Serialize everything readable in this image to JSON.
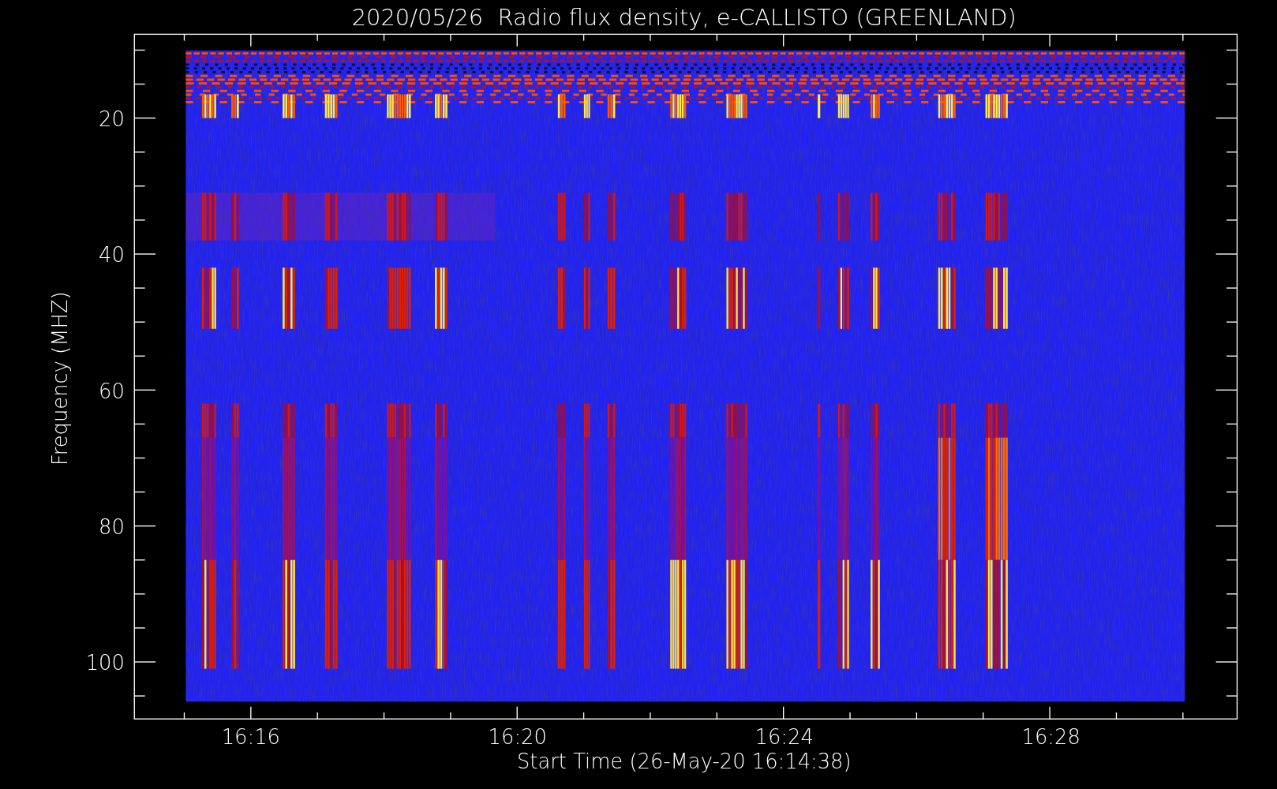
{
  "chart": {
    "title": "2020/05/26  Radio flux density, e-CALLISTO (GREENLAND)",
    "ylabel": "Frequency (MHZ)",
    "xlabel": "Start Time (26-May-20 16:14:38)",
    "yticks": [
      "20",
      "40",
      "60",
      "80",
      "100"
    ],
    "xticks": [
      "16:16",
      "16:20",
      "16:24",
      "16:28"
    ]
  }
}
